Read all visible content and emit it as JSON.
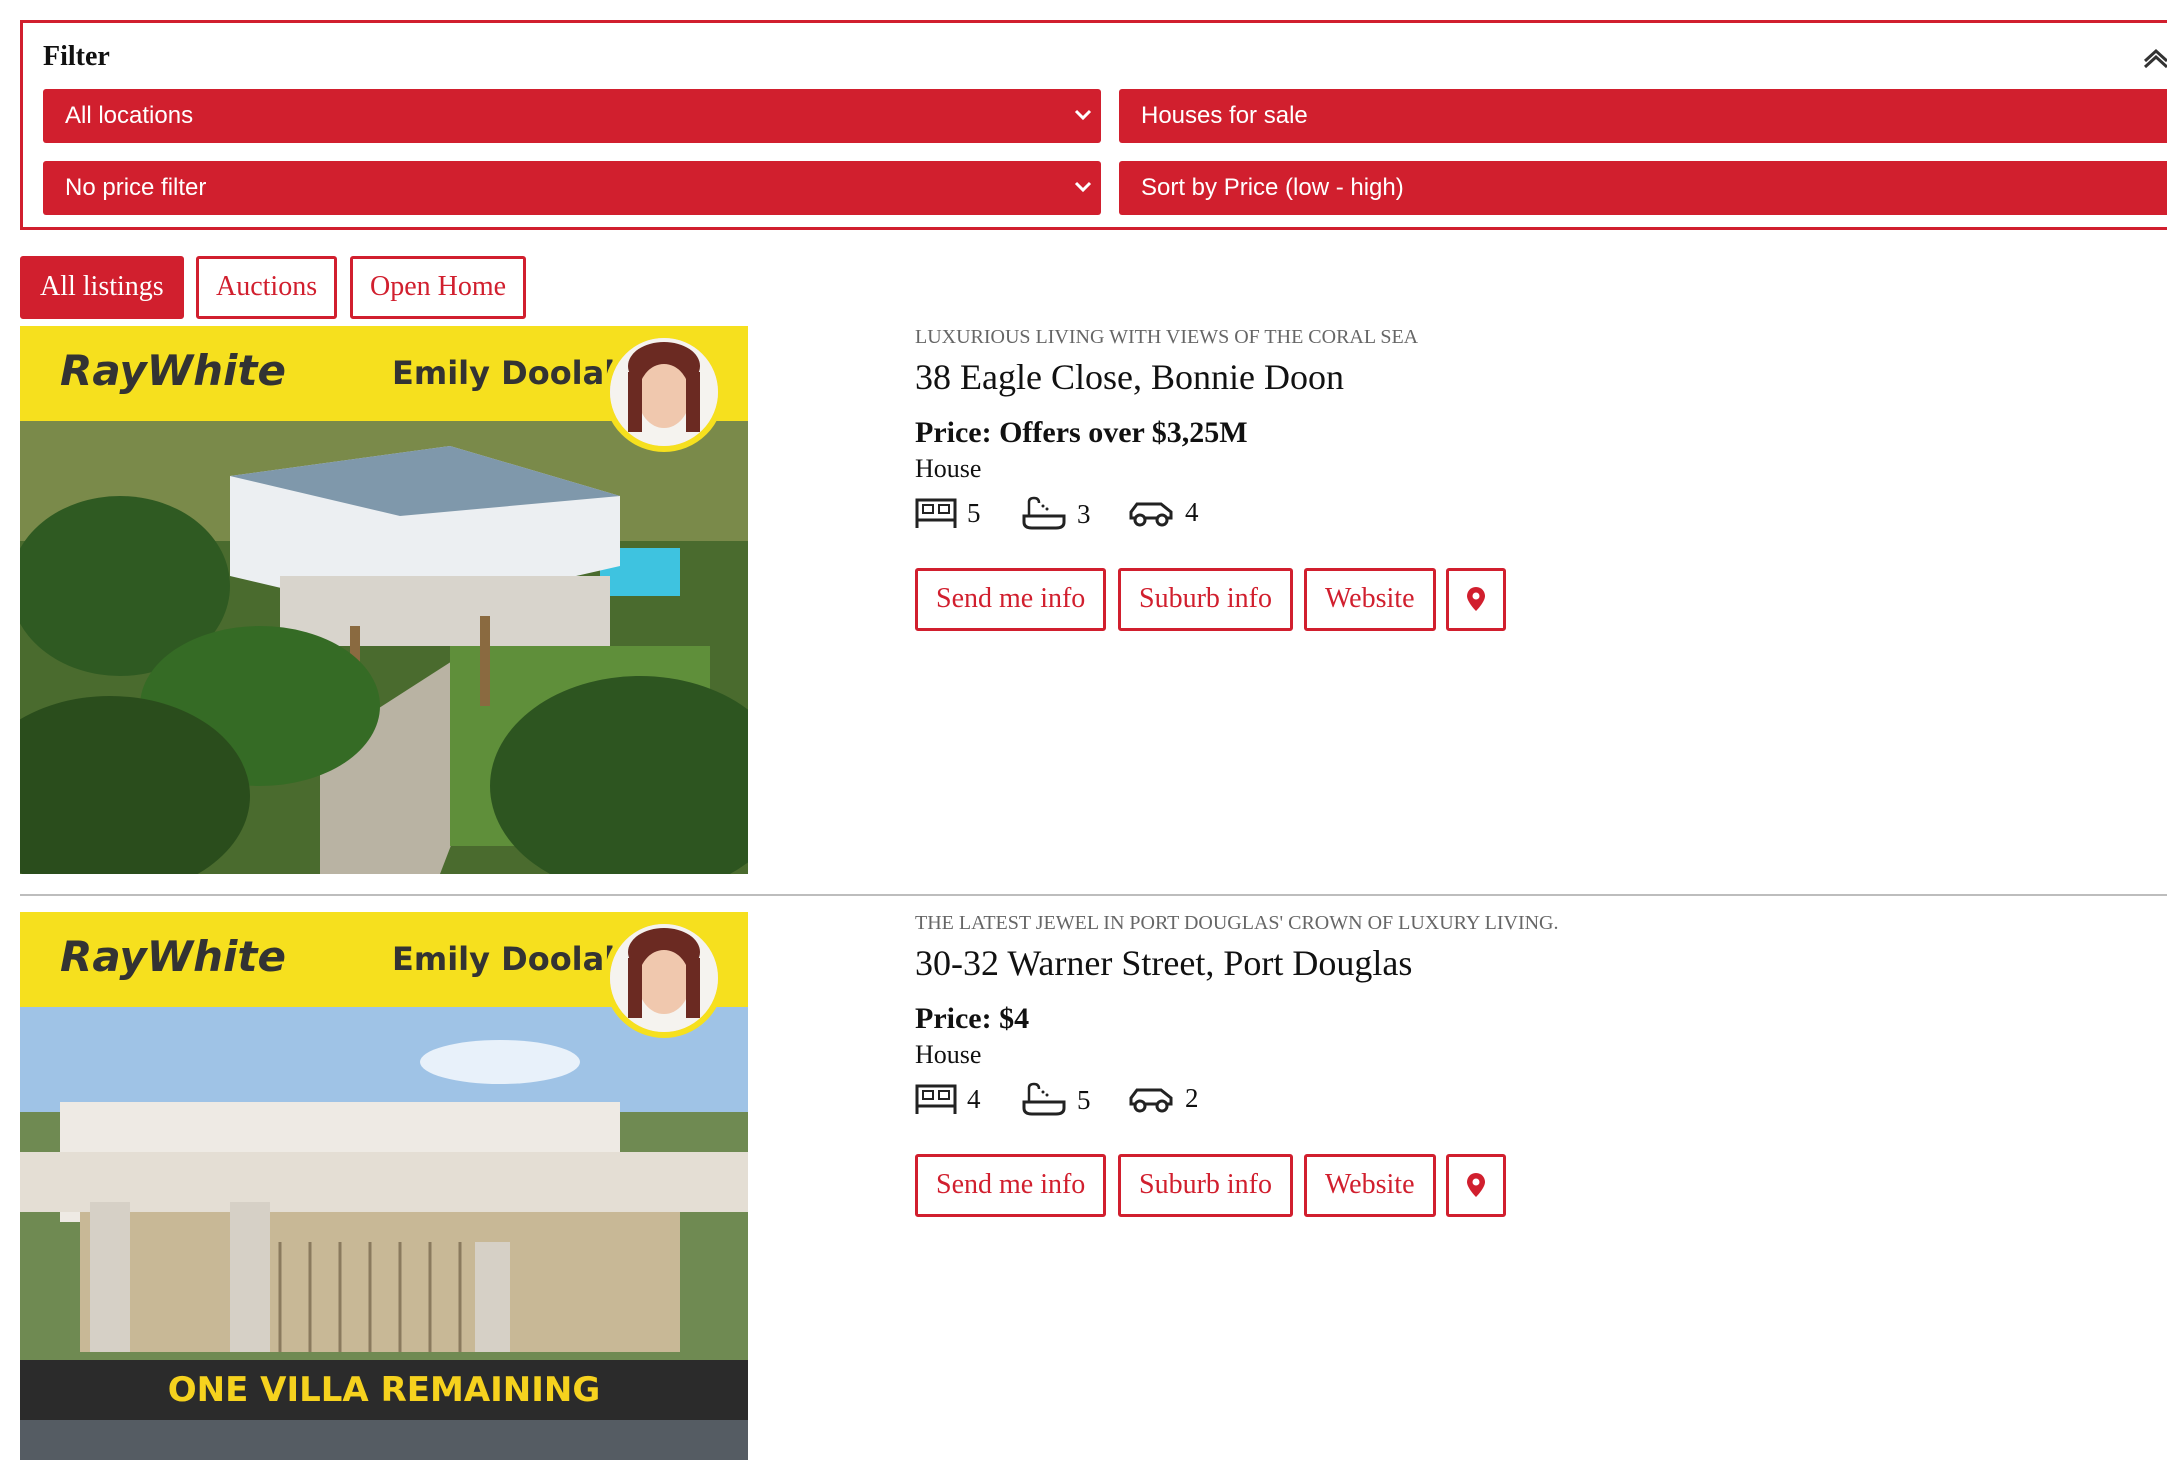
{
  "filter": {
    "title": "Filter",
    "location": "All locations",
    "category": "Houses for sale",
    "price": "No price filter",
    "sort": "Sort by Price (low - high)"
  },
  "tabs": [
    "All listings",
    "Auctions",
    "Open Home"
  ],
  "colors": {
    "accent": "#d11f2e",
    "banner": "#f6e01e"
  },
  "listings": [
    {
      "banner_logo": "RayWhite",
      "banner_agent": "Emily Doolah",
      "tagline": "LUXURIOUS LIVING WITH VIEWS OF THE CORAL SEA",
      "address": "38 Eagle Close, Bonnie Doon",
      "price": "Price: Offers over $3,25M",
      "type": "House",
      "beds": "5",
      "baths": "3",
      "cars": "4",
      "actions": {
        "send": "Send me info",
        "suburb": "Suburb info",
        "website": "Website",
        "map_icon": "map-pin-icon"
      }
    },
    {
      "banner_logo": "RayWhite",
      "banner_agent": "Emily Doolah",
      "photo_caption": "ONE VILLA REMAINING",
      "tagline": "THE LATEST JEWEL IN PORT DOUGLAS' CROWN OF LUXURY LIVING.",
      "address": "30-32 Warner Street, Port Douglas",
      "price": "Price: $4",
      "type": "House",
      "beds": "4",
      "baths": "5",
      "cars": "2",
      "actions": {
        "send": "Send me info",
        "suburb": "Suburb info",
        "website": "Website",
        "map_icon": "map-pin-icon"
      }
    }
  ]
}
